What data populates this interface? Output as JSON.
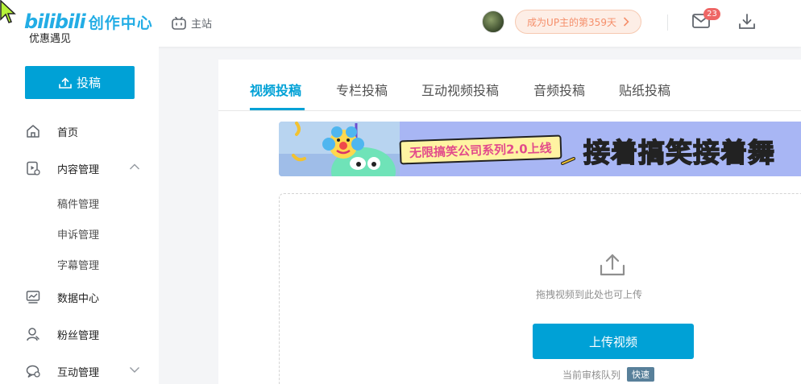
{
  "header": {
    "brand": "bilibili",
    "brand_text": "创作中心",
    "brand_sub": "优惠遇见",
    "main_site": "主站",
    "up_days": "成为UP主的第359天",
    "mail_badge": "23",
    "icons": [
      "tv-icon",
      "mail-icon",
      "download-icon",
      "chevron-right-icon"
    ]
  },
  "sidebar": {
    "upload_button": "投稿",
    "items": [
      {
        "label": "首页",
        "icon": "home-icon"
      },
      {
        "label": "内容管理",
        "icon": "content-icon",
        "expanded": true
      },
      {
        "label": "数据中心",
        "icon": "chart-icon"
      },
      {
        "label": "粉丝管理",
        "icon": "user-icon"
      },
      {
        "label": "互动管理",
        "icon": "chat-icon",
        "expanded": false
      }
    ],
    "sub_items": [
      "稿件管理",
      "申诉管理",
      "字幕管理"
    ]
  },
  "main": {
    "tabs": [
      "视频投稿",
      "专栏投稿",
      "互动视频投稿",
      "音频投稿",
      "贴纸投稿"
    ],
    "active_tab": "视频投稿",
    "banner": {
      "chip": "无限搞笑公司系列2.0上线",
      "headline": "接着搞笑接着舞"
    },
    "drop_hint": "拖拽视频到此处也可上传",
    "upload_button": "上传视频",
    "queue_label": "当前审核队列",
    "queue_status": "快速"
  },
  "colors": {
    "accent": "#00a1d6",
    "badge": "#ee6665",
    "up_days_text": "#f58f6b"
  }
}
